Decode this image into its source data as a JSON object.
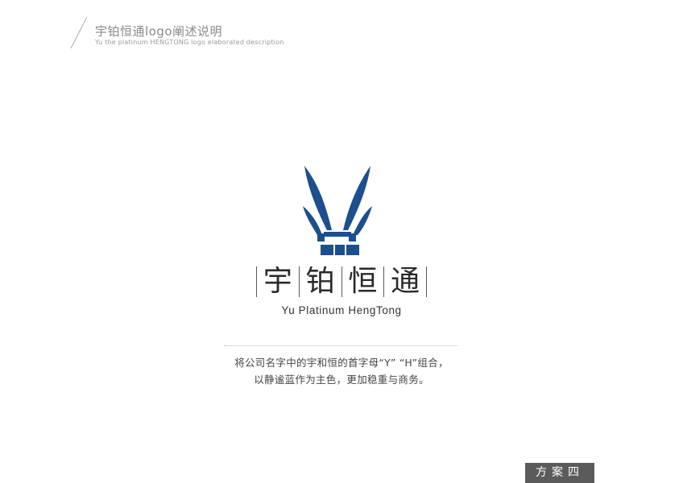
{
  "header": {
    "title": "宇铂恒通logo阐述说明",
    "subtitle": "Yu the platinum HENGTONG logo elaborated description"
  },
  "logo": {
    "icon": "yh-leaf-logo-icon",
    "color": "#1d4f8f",
    "name_chars": [
      "宇",
      "铂",
      "恒",
      "通"
    ],
    "name_en": "Yu Platinum HengTong"
  },
  "description": {
    "line1": "将公司名字中的宇和恒的首字母“Y” “H”组合，",
    "line2": "以静谧蓝作为主色，更加稳重与商务。"
  },
  "badge": {
    "label": "方案四"
  }
}
